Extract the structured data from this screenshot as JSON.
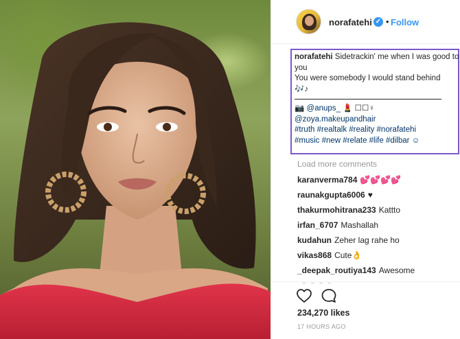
{
  "post": {
    "username": "norafatehi",
    "verified_mark": "✓",
    "separator": "•",
    "follow_label": "Follow"
  },
  "caption": {
    "username": "norafatehi",
    "line1": "Sidetrackin' me when I was good to you",
    "line2": "You were somebody I would stand behind",
    "notes": "🎶♪",
    "photo_credit_icon": "📷",
    "photographer": "@anups_",
    "extra_symbols": "💄 ☐☐♀",
    "makeup": "@zoya.makeupandhair",
    "hashtags_line1": "#truth #realtalk #reality #norafatehi",
    "hashtags_line2": "#music #new #relate #life #dilbar ☺"
  },
  "load_more": "Load more comments",
  "comments": [
    {
      "user": "karanverma784",
      "text": "💕💕💕💕"
    },
    {
      "user": "raunakgupta6006",
      "text": "♥"
    },
    {
      "user": "thakurmohitrana233",
      "text": "Kattto"
    },
    {
      "user": "irfan_6707",
      "text": "Mashallah"
    },
    {
      "user": "kudahun",
      "text": "Zeher lag rahe ho"
    },
    {
      "user": "vikas868",
      "text": "Cute👌"
    },
    {
      "user": "_deepak_routiya143",
      "text": "Awesome"
    },
    {
      "user": "",
      "text": "☺☺☺☺"
    }
  ],
  "likes": "234,270 likes",
  "time": "17 HOURS AGO",
  "icons": {
    "like": "heart-icon",
    "comment": "comment-bubble-icon",
    "verified": "verified-badge-icon"
  },
  "colors": {
    "accent": "#3897f0",
    "highlight_box": "#7b57c8",
    "link": "#003569",
    "dress": "#d8283c"
  }
}
